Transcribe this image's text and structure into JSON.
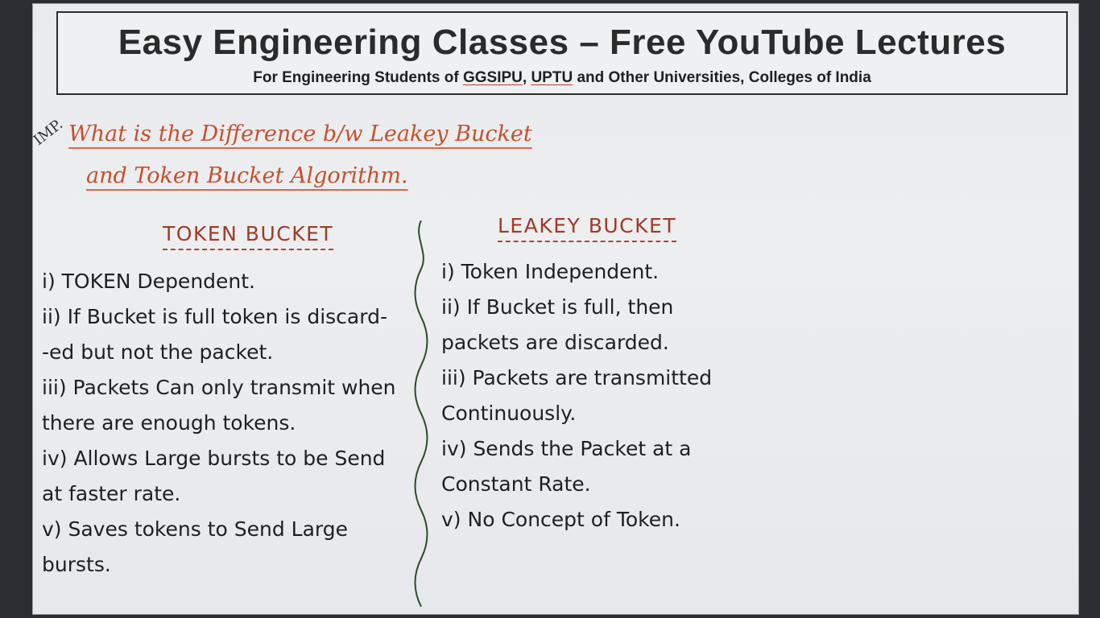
{
  "banner": {
    "title": "Easy Engineering Classes – Free YouTube Lectures",
    "subtitle_prefix": "For Engineering Students of ",
    "uni1": "GGSIPU",
    "sep": ", ",
    "uni2": "UPTU",
    "subtitle_suffix": " and Other Universities, Colleges of India"
  },
  "imp_label": "IMP.",
  "question": {
    "line1": "What is the Difference b/w Leakey Bucket",
    "line2": "and Token Bucket Algorithm."
  },
  "token_bucket": {
    "heading": "TOKEN BUCKET",
    "points": [
      "i) TOKEN Dependent.",
      "ii) If Bucket is full token is discard-",
      "-ed but not the packet.",
      "iii) Packets Can only transmit when",
      "there are enough tokens.",
      "iv) Allows Large bursts to be Send",
      "at faster rate.",
      "v) Saves tokens to Send Large bursts."
    ]
  },
  "leaky_bucket": {
    "heading": "LEAKEY BUCKET",
    "points": [
      "i) Token Independent.",
      "ii) If Bucket is full, then",
      "packets are discarded.",
      "iii) Packets are transmitted",
      "Continuously.",
      "iv) Sends the Packet at a",
      "Constant Rate.",
      "v) No Concept of Token."
    ]
  },
  "colors": {
    "heading_red": "#a23a28",
    "question_orange": "#c8502b",
    "ink": "#1f1f1f",
    "divider_green": "#2f4a2f"
  }
}
